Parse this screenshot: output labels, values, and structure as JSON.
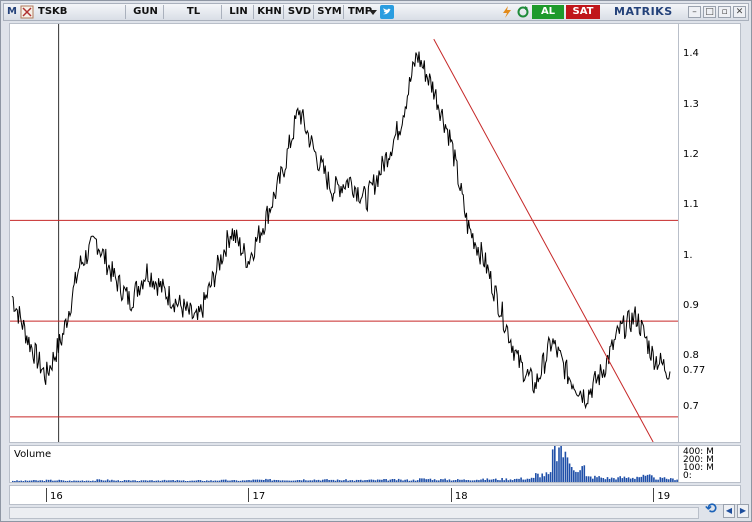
{
  "toolbar": {
    "m_icon_label": "M",
    "symbol": "TSKB",
    "buttons": [
      {
        "label": "GUN"
      },
      {
        "label": "TL"
      },
      {
        "label": "LIN"
      },
      {
        "label": "KHN"
      },
      {
        "label": "SVD"
      },
      {
        "label": "SYM"
      },
      {
        "label": "TMP"
      }
    ],
    "buy_label": "AL",
    "sell_label": "SAT",
    "brand": "MATRIKS",
    "window_controls": [
      "–",
      "□",
      "▫",
      "✕"
    ]
  },
  "chart_data": {
    "type": "line",
    "series": [
      {
        "x": [
          "2016-01",
          "2016-02",
          "2016-03",
          "2016-04",
          "2016-05",
          "2016-06",
          "2016-07",
          "2016-08",
          "2016-09",
          "2016-10",
          "2016-11",
          "2016-12",
          "2017-01",
          "2017-02",
          "2017-03",
          "2017-04",
          "2017-05",
          "2017-06",
          "2017-07",
          "2017-08",
          "2017-09",
          "2017-10",
          "2017-11",
          "2017-12",
          "2018-01",
          "2018-02",
          "2018-03",
          "2018-04",
          "2018-05",
          "2018-06",
          "2018-07",
          "2018-08",
          "2018-09",
          "2018-10",
          "2018-11",
          "2018-12",
          "2019-01",
          "2019-02",
          "2019-03",
          "2019-04"
        ],
        "values": [
          0.92,
          0.83,
          0.76,
          0.84,
          0.98,
          1.03,
          0.96,
          0.91,
          0.97,
          0.93,
          0.9,
          0.87,
          0.96,
          1.05,
          0.99,
          1.07,
          1.16,
          1.29,
          1.2,
          1.13,
          1.15,
          1.11,
          1.18,
          1.26,
          1.4,
          1.33,
          1.23,
          1.06,
          0.99,
          0.89,
          0.79,
          0.74,
          0.83,
          0.76,
          0.72,
          0.77,
          0.85,
          0.88,
          0.8,
          0.77
        ]
      }
    ],
    "y_ticks": [
      "1.4",
      "1.3",
      "1.2",
      "1.1",
      "1.",
      "0.9",
      "0.8",
      "0.77",
      "0.7"
    ],
    "last_value": "0.77",
    "ylim": [
      0.63,
      1.46
    ],
    "x_ticks": [
      "16",
      "17",
      "18",
      "19"
    ],
    "horizontal_lines": [
      1.07,
      0.87,
      0.68
    ],
    "trendline": {
      "from": [
        "2018-02",
        1.43
      ],
      "to": [
        "2019-03",
        0.63
      ]
    },
    "cursor_x": "2016-04",
    "grid": false,
    "volume": {
      "title": "Volume",
      "labels": [
        "400: M",
        "200: M",
        "100: M",
        "0:"
      ],
      "values": [
        5,
        6,
        7,
        5,
        6,
        8,
        6,
        5,
        7,
        6,
        5,
        6,
        7,
        6,
        8,
        9,
        8,
        10,
        9,
        8,
        7,
        8,
        9,
        8,
        12,
        10,
        9,
        10,
        11,
        12,
        14,
        30,
        120,
        60,
        20,
        16,
        18,
        22,
        14,
        12
      ]
    }
  },
  "colors": {
    "price_line": "#000000",
    "support_lines": "#c62828",
    "trendline": "#c62828",
    "volume_bars": "#1f4fa8",
    "buy": "#1e9a2c",
    "sell": "#c0161b"
  }
}
